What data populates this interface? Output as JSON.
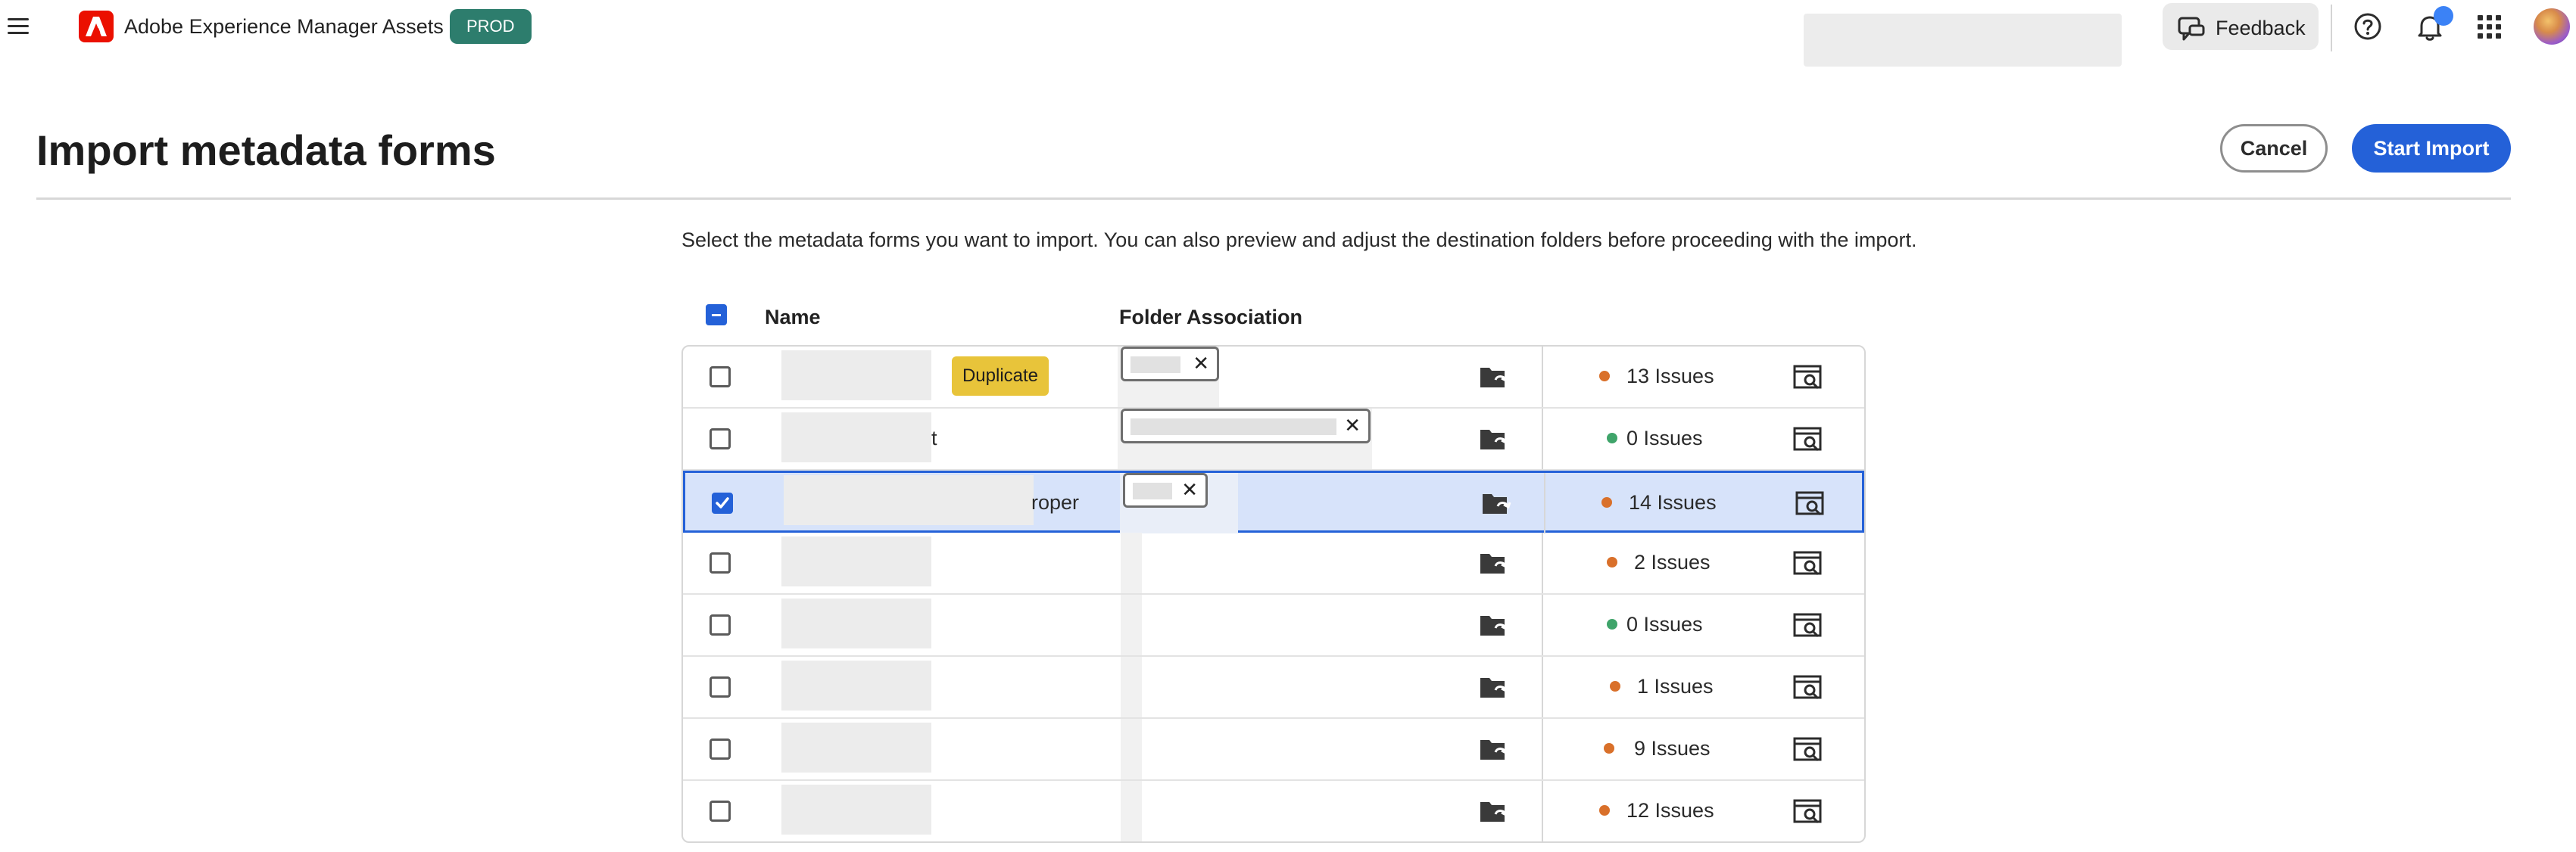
{
  "header": {
    "app_title": "Adobe Experience Manager Assets",
    "env_badge": "PROD",
    "feedback_label": "Feedback",
    "icons": [
      "menu-icon",
      "adobe-logo-icon",
      "feedback-icon",
      "help-icon",
      "bell-icon",
      "apps-grid-icon",
      "avatar"
    ]
  },
  "page": {
    "title": "Import metadata forms",
    "cancel_label": "Cancel",
    "start_label": "Start Import",
    "description": "Select the metadata forms you want to import. You can also preview and adjust the destination folders before proceeding with the import."
  },
  "table": {
    "columns": {
      "name": "Name",
      "folder": "Folder Association"
    },
    "rows": [
      {
        "name_tail": "",
        "badge": "Duplicate",
        "checked": false,
        "issues": "13 Issues",
        "status": "warning"
      },
      {
        "name_tail": "t",
        "badge": "",
        "checked": false,
        "issues": "0 Issues",
        "status": "ok"
      },
      {
        "name_tail": "roper",
        "badge": "",
        "checked": true,
        "issues": "14 Issues",
        "status": "warning"
      },
      {
        "name_tail": "",
        "badge": "",
        "checked": false,
        "issues": "2 Issues",
        "status": "warning"
      },
      {
        "name_tail": "",
        "badge": "",
        "checked": false,
        "issues": "0 Issues",
        "status": "ok"
      },
      {
        "name_tail": "",
        "badge": "",
        "checked": false,
        "issues": "1 Issues",
        "status": "warning"
      },
      {
        "name_tail": "",
        "badge": "",
        "checked": false,
        "issues": "9 Issues",
        "status": "warning"
      },
      {
        "name_tail": "",
        "badge": "",
        "checked": false,
        "issues": "12 Issues",
        "status": "warning"
      }
    ]
  },
  "colors": {
    "accent": "#2461d8",
    "brand": "#eb1000",
    "env_badge": "#2d7d6d",
    "status_warning": "#d9702a",
    "status_ok": "#3fa46a",
    "duplicate_badge": "#e8c43a",
    "selected_row": "#d7e3fa"
  }
}
